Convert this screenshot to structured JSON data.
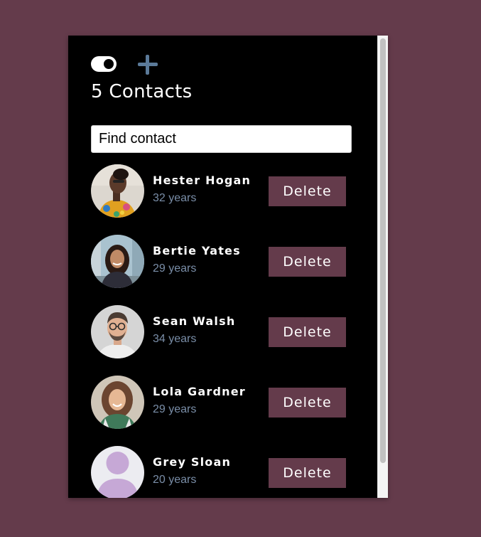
{
  "header": {
    "title": "5 Contacts",
    "toggle_state": "on",
    "add_icon": "plus-icon"
  },
  "search": {
    "placeholder": "Find contact",
    "value": ""
  },
  "contacts": [
    {
      "name": "Hester Hogan",
      "age": "32 years",
      "delete_label": "Delete",
      "avatar": "photo-woman-colorful-top"
    },
    {
      "name": "Bertie Yates",
      "age": "29 years",
      "delete_label": "Delete",
      "avatar": "photo-woman-street"
    },
    {
      "name": "Sean Walsh",
      "age": "34 years",
      "delete_label": "Delete",
      "avatar": "photo-man-glasses"
    },
    {
      "name": "Lola Gardner",
      "age": "29 years",
      "delete_label": "Delete",
      "avatar": "photo-woman-curly-hair"
    },
    {
      "name": "Grey Sloan",
      "age": "20 years",
      "delete_label": "Delete",
      "avatar": "default-person-icon"
    }
  ],
  "colors": {
    "page_background": "#643b4b",
    "panel_background": "#000000",
    "delete_button": "#643b4b",
    "add_icon": "#5b7a99",
    "age_text": "#7a8ea8",
    "default_avatar_background": "#ececf1",
    "default_avatar_figure": "#c6a8d6"
  }
}
